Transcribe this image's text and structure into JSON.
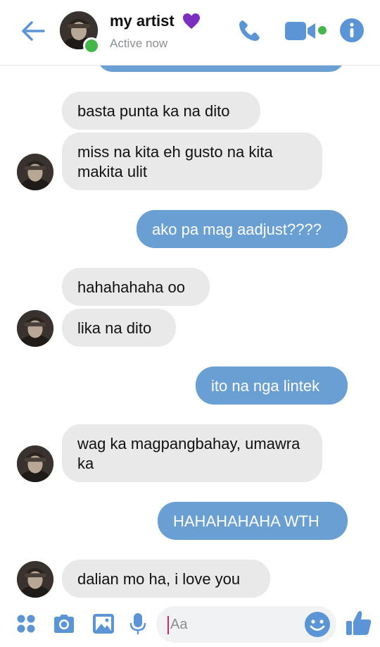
{
  "header": {
    "title": "my artist",
    "status": "Active now",
    "accent_color": "#5b95d5",
    "online_color": "#44b74a",
    "heart_color": "#7b2fbf"
  },
  "messages": [
    {
      "side": "in",
      "text": "basta punta ka na dito"
    },
    {
      "side": "in",
      "text": "miss na kita eh gusto na kita makita ulit"
    },
    {
      "side": "out",
      "text": "ako pa mag aadjust????"
    },
    {
      "side": "in",
      "text": "hahahahaha oo"
    },
    {
      "side": "in",
      "text": "lika na dito"
    },
    {
      "side": "out",
      "text": "ito na nga lintek"
    },
    {
      "side": "in",
      "text": "wag ka magpangbahay, umawra ka"
    },
    {
      "side": "out",
      "text": "HAHAHAHAHA WTH"
    },
    {
      "side": "in",
      "text": "dalian mo ha, i love you"
    }
  ],
  "composer": {
    "placeholder": "Aa",
    "icons": [
      "apps-icon",
      "camera-icon",
      "gallery-icon",
      "microphone-icon",
      "emoji-icon",
      "thumbs-up-icon"
    ]
  },
  "colors": {
    "outgoing_bubble": "#6a9fd3",
    "incoming_bubble": "#e9e9ea"
  }
}
